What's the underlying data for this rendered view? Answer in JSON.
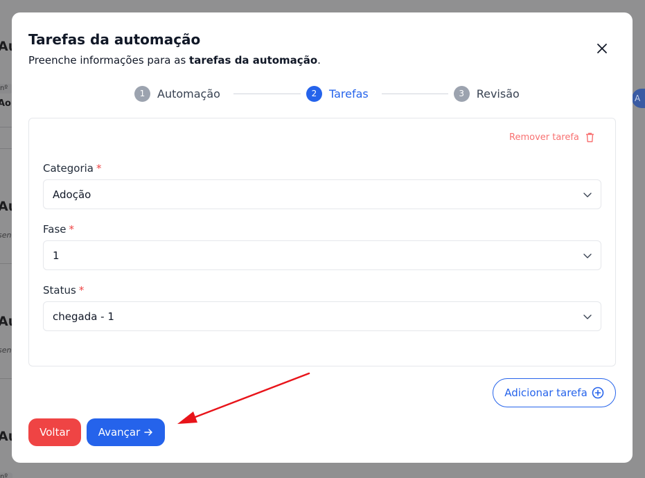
{
  "modal": {
    "title": "Tarefas da automação",
    "subtitle_prefix": "Preenche informações para as ",
    "subtitle_bold": "tarefas da automação",
    "subtitle_suffix": "."
  },
  "stepper": {
    "steps": [
      {
        "number": "1",
        "label": "Automação",
        "state": "done"
      },
      {
        "number": "2",
        "label": "Tarefas",
        "state": "active"
      },
      {
        "number": "3",
        "label": "Revisão",
        "state": "pending"
      }
    ]
  },
  "task": {
    "remove_label": "Remover tarefa",
    "required_mark": "*",
    "fields": [
      {
        "label": "Categoria",
        "value": "Adoção"
      },
      {
        "label": "Fase",
        "value": "1"
      },
      {
        "label": "Status",
        "value": "chegada - 1"
      }
    ]
  },
  "actions": {
    "add_task_label": "Adicionar tarefa",
    "back_label": "Voltar",
    "next_label": "Avançar"
  },
  "background": {
    "heading_fragment": "Au",
    "chip_text": "nº",
    "row_text": "Ao",
    "italic_fragment": "sen",
    "avatar_letter": "A"
  },
  "colors": {
    "primary": "#2563eb",
    "danger": "#ef4444",
    "danger_light": "#f87171",
    "annotation_arrow": "#e8141a"
  },
  "icons": {
    "close": "close-icon",
    "trash": "trash-icon",
    "chevron": "chevron-down-icon",
    "plus_circle": "plus-circle-icon",
    "arrow_right": "arrow-right-icon"
  }
}
